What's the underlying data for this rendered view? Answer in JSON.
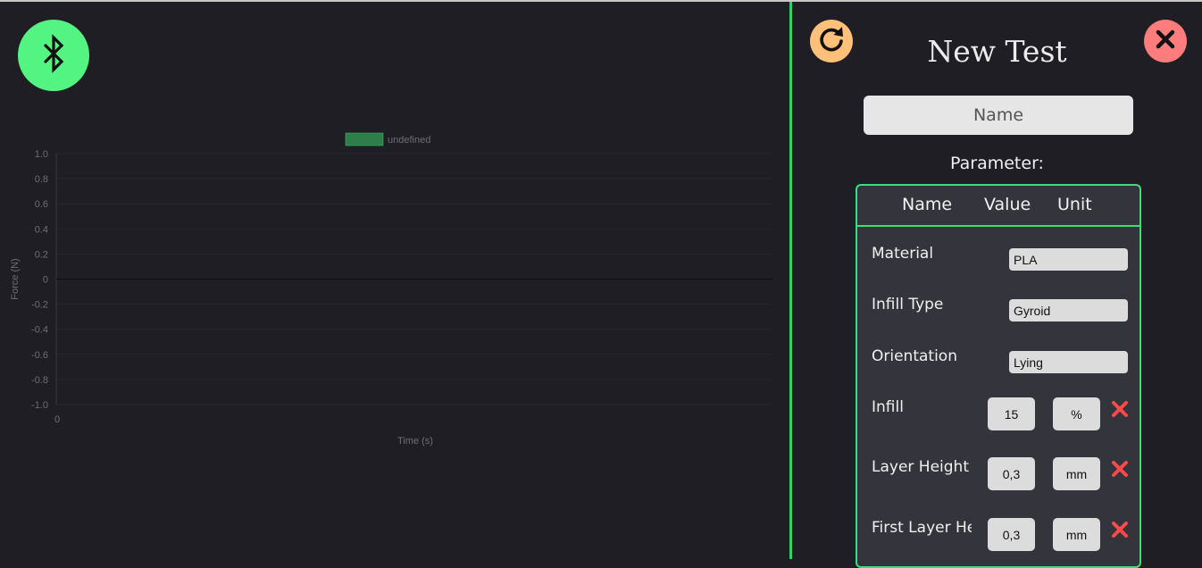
{
  "colors": {
    "accent_green": "#54f483",
    "refresh": "#ffc07a",
    "close": "#ff7c7c",
    "border_green": "#3ddf74",
    "delete_red": "#ff4a4a"
  },
  "icons": {
    "bluetooth": "bluetooth-icon",
    "refresh": "refresh-icon",
    "close": "close-icon",
    "delete": "delete-x-icon"
  },
  "chart_data": {
    "type": "bar",
    "legend": [
      "undefined"
    ],
    "series": [
      {
        "name": "undefined",
        "values": []
      }
    ],
    "x_ticks": [
      "0"
    ],
    "y_ticks": [
      "1.0",
      "0.8",
      "0.6",
      "0.4",
      "0.2",
      "0",
      "-0.2",
      "-0.4",
      "-0.6",
      "-0.8",
      "-1.0"
    ],
    "ylim": [
      -1.0,
      1.0
    ],
    "xlabel": "Time (s)",
    "ylabel": "Force (N)",
    "legend_placement": "top-center",
    "grid": true
  },
  "panel": {
    "title": "New Test",
    "name_placeholder": "Name",
    "parameter_label": "Parameter:",
    "headers": {
      "name": "Name",
      "value": "Value",
      "unit": "Unit"
    },
    "text_params": [
      {
        "label": "Material",
        "value": "PLA"
      },
      {
        "label": "Infill Type",
        "value": "Gyroid"
      },
      {
        "label": "Orientation",
        "value": "Lying"
      }
    ],
    "num_params": [
      {
        "label": "Infill",
        "value": "15",
        "unit": "%"
      },
      {
        "label": "Layer Height",
        "value": "0,3",
        "unit": "mm"
      },
      {
        "label": "First Layer Height",
        "value": "0,3",
        "unit": "mm"
      }
    ]
  }
}
